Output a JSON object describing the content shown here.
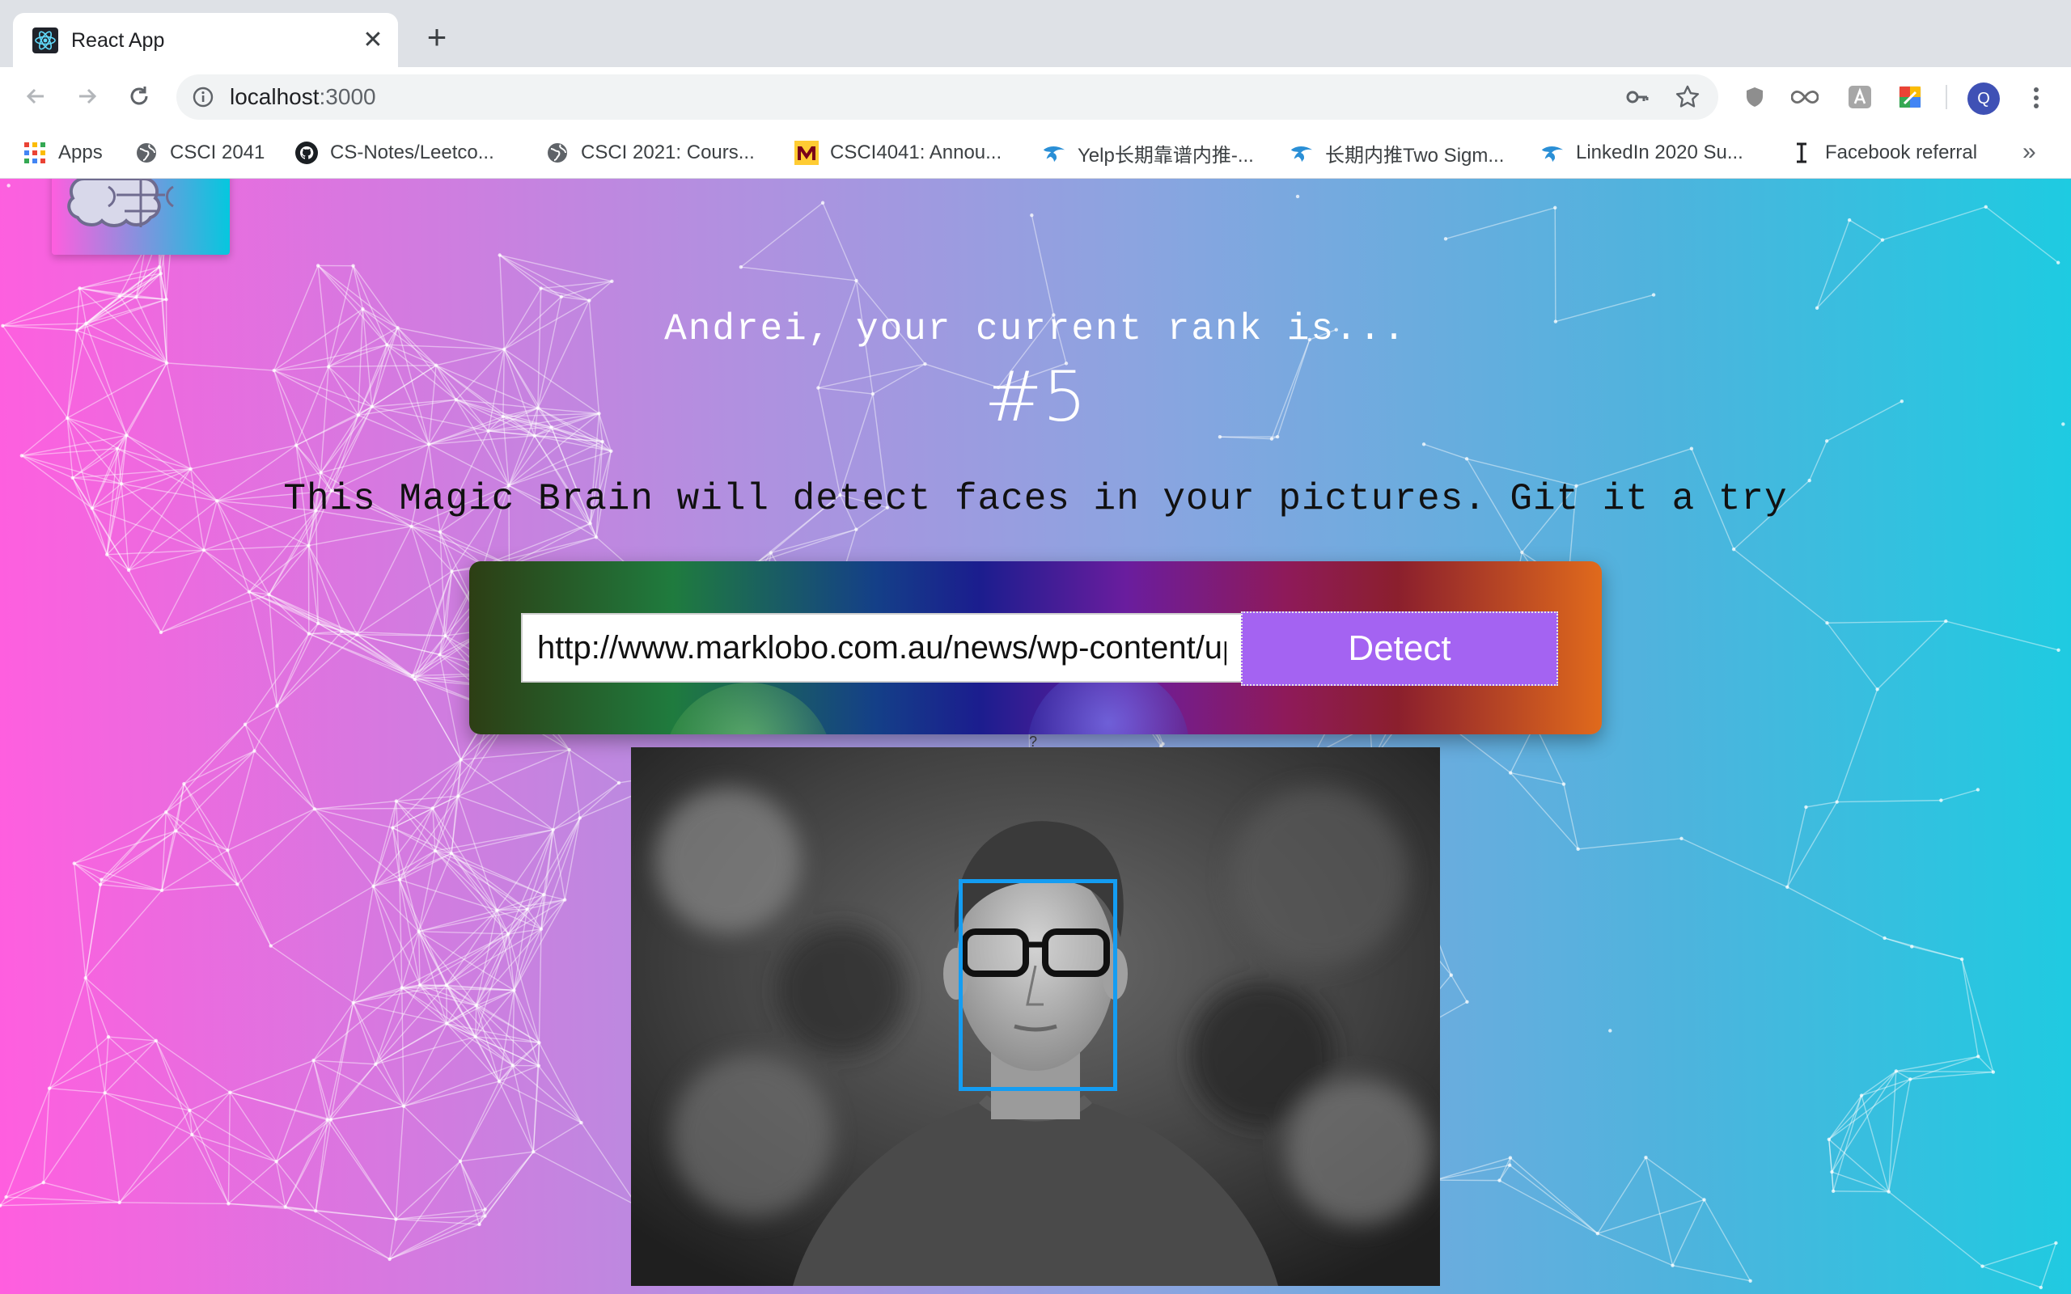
{
  "browser": {
    "tab": {
      "title": "React App",
      "close": "✕"
    },
    "new_tab": "+",
    "address": {
      "host": "localhost",
      "port": ":3000"
    },
    "bookmarks": [
      {
        "label": "Apps",
        "icon": "apps-grid-icon"
      },
      {
        "label": "CSCI 2041",
        "icon": "globe-icon"
      },
      {
        "label": "CS-Notes/Leetco...",
        "icon": "github-icon"
      },
      {
        "label": "CSCI 2021: Cours...",
        "icon": "globe-icon"
      },
      {
        "label": "CSCI4041: Annou...",
        "icon": "umn-icon"
      },
      {
        "label": "Yelp长期靠谱内推-...",
        "icon": "bird-icon"
      },
      {
        "label": "长期内推Two Sigm...",
        "icon": "bird-icon"
      },
      {
        "label": "LinkedIn 2020 Su...",
        "icon": "bird-icon"
      },
      {
        "label": "Facebook referral",
        "icon": "text-cursor-icon"
      }
    ],
    "bookmarks_more": "»",
    "profile_initial": "Q"
  },
  "app": {
    "rank_text": "Andrei, your current rank is...",
    "rank_value": "#5",
    "tagline": "This Magic Brain will detect faces in your pictures. Git it a try",
    "url_input": {
      "value": "http://www.marklobo.com.au/news/wp-content/uploads/"
    },
    "detect_label": "Detect",
    "stray_char": "?"
  },
  "colors": {
    "gradient_left": "#ff5edf",
    "gradient_right": "#1ecbe1",
    "detect_button": "#a463f2",
    "face_box": "#149df2"
  }
}
